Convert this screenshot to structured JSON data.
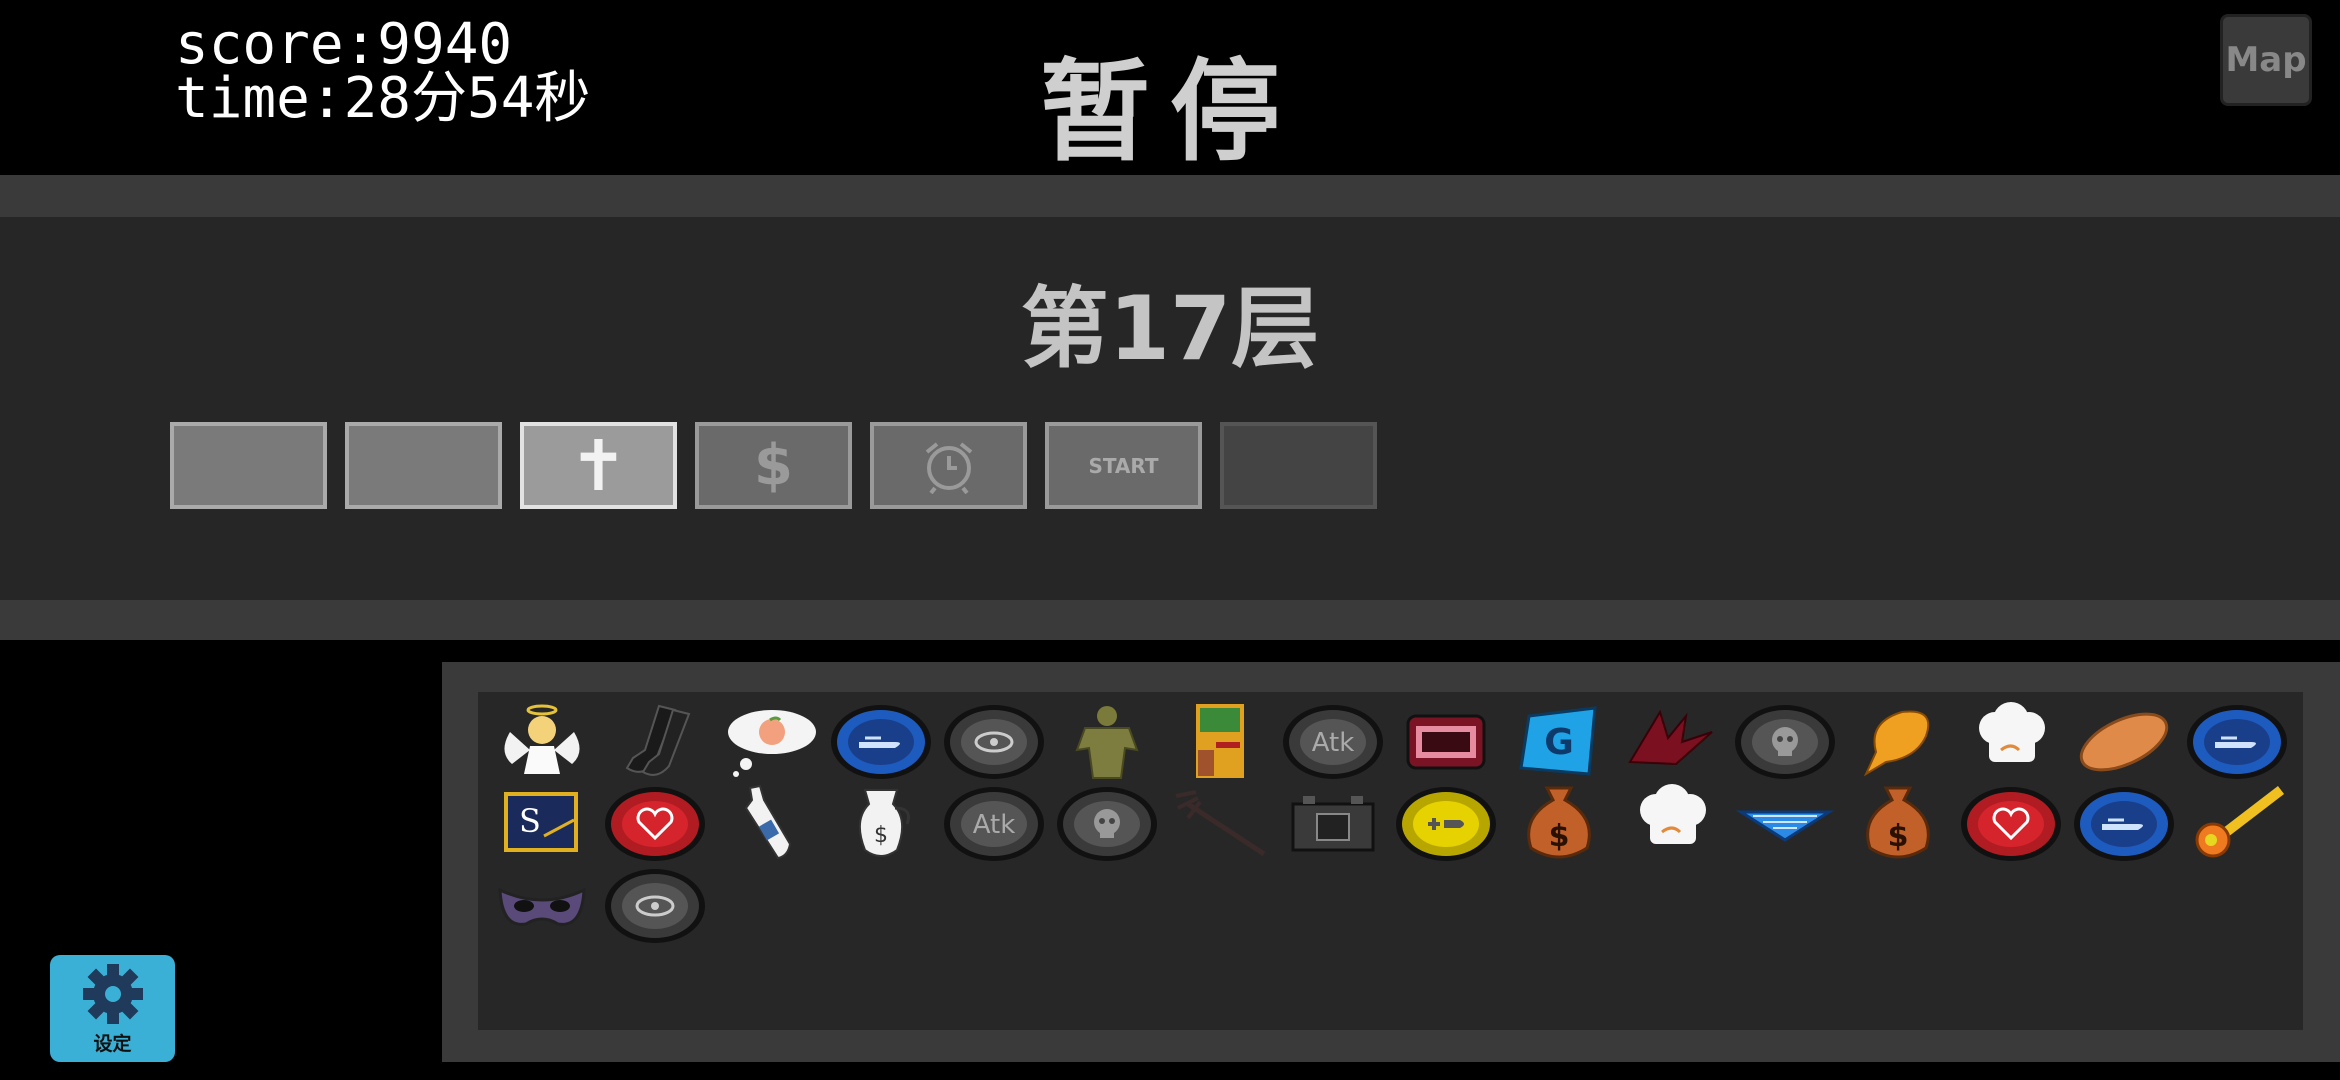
{
  "hud": {
    "score": "score:9940",
    "time": "time:28分54秒"
  },
  "title": "暂停",
  "map_button": "Map",
  "floor_label": "第17层",
  "rooms": [
    {
      "type": "normal",
      "symbol": ""
    },
    {
      "type": "normal",
      "symbol": ""
    },
    {
      "type": "current",
      "symbol": "✝"
    },
    {
      "type": "shop",
      "symbol": "$"
    },
    {
      "type": "clock",
      "symbol": "⏰"
    },
    {
      "type": "start",
      "symbol": "START"
    },
    {
      "type": "dim",
      "symbol": ""
    }
  ],
  "items_row1": [
    "angel",
    "socks",
    "peach-thought",
    "blue-bullet-pill",
    "eye-pill",
    "green-statue",
    "poster",
    "atk-pill",
    "battery-box",
    "g-sticker",
    "red-wings",
    "skull-pill",
    "angry-bubble",
    "chef-hat",
    "potato",
    "blue-bullet-pill"
  ],
  "items_row2": [
    "s-card",
    "heart-pill",
    "bottle",
    "jug-dollar",
    "atk-pill",
    "skull-pill",
    "trident",
    "battery",
    "yellow-plus-pill",
    "money-bag",
    "chef-hat",
    "blue-fan",
    "money-bag",
    "heart-pill",
    "blue-bullet-pill",
    "meteor"
  ],
  "items_row3": [
    "mask",
    "eye-pill"
  ],
  "settings_label": "设定"
}
